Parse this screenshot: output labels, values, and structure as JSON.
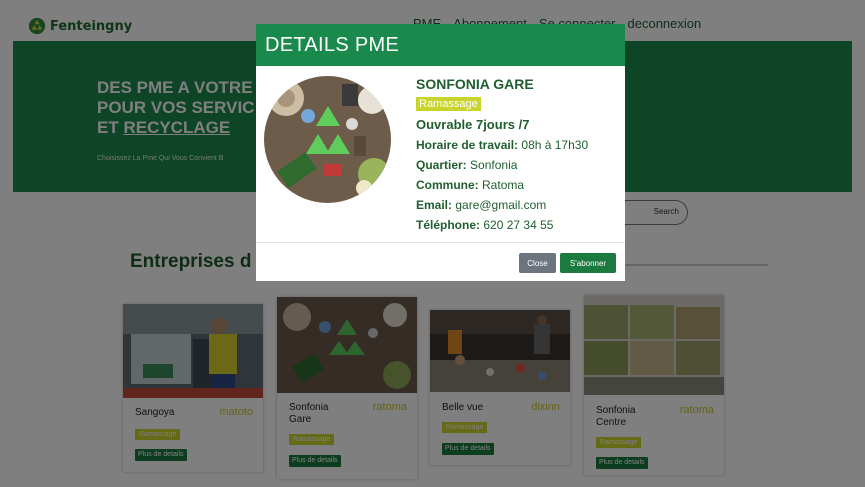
{
  "navbar": {
    "brand": "Fenteingny",
    "links": [
      "PME",
      "Abonnement",
      "Se connecter",
      "deconnexion"
    ]
  },
  "hero": {
    "title_line1": "DES PME A VOTRE",
    "title_line2": "POUR VOS SERVIC",
    "title_line3_prefix": "ET ",
    "title_line3_link": "RECYCLAGE",
    "subtitle": "Choisissez La Pme Qui Vous Convient B"
  },
  "search": {
    "button": "Search"
  },
  "section": {
    "title": "Entreprises d"
  },
  "cards": [
    {
      "name": "Sangoya",
      "city": "matoto",
      "tag": "Ramassage",
      "button": "Plus de details"
    },
    {
      "name": "Sonfonia Gare",
      "city": "ratoma",
      "tag": "Ramassage",
      "button": "Plus de details"
    },
    {
      "name": "Belle vue",
      "city": "dixinn",
      "tag": "Ramassage",
      "button": "Plus de details"
    },
    {
      "name": "Sonfonia Centre",
      "city": "ratoma",
      "tag": "Ramassage",
      "button": "Plus de details"
    }
  ],
  "modal": {
    "title": "DETAILS PME",
    "name": "SONFONIA GARE",
    "tag": "Ramassage",
    "open": "Ouvrable 7jours /7",
    "hours_label": "Horaire de travail:",
    "hours_value": "08h à 17h30",
    "quartier_label": "Quartier:",
    "quartier_value": "Sonfonia",
    "commune_label": "Commune:",
    "commune_value": "Ratoma",
    "email_label": "Email:",
    "email_value": "gare@gmail.com",
    "phone_label": "Téléphone:",
    "phone_value": "620 27 34 55",
    "close_button": "Close",
    "subscribe_button": "S'abonner"
  },
  "colors": {
    "primary_green": "#1a8a4c",
    "dark_green_text": "#1f5e2f",
    "tag_yellow": "#c8d42b",
    "close_gray": "#6c757d"
  }
}
